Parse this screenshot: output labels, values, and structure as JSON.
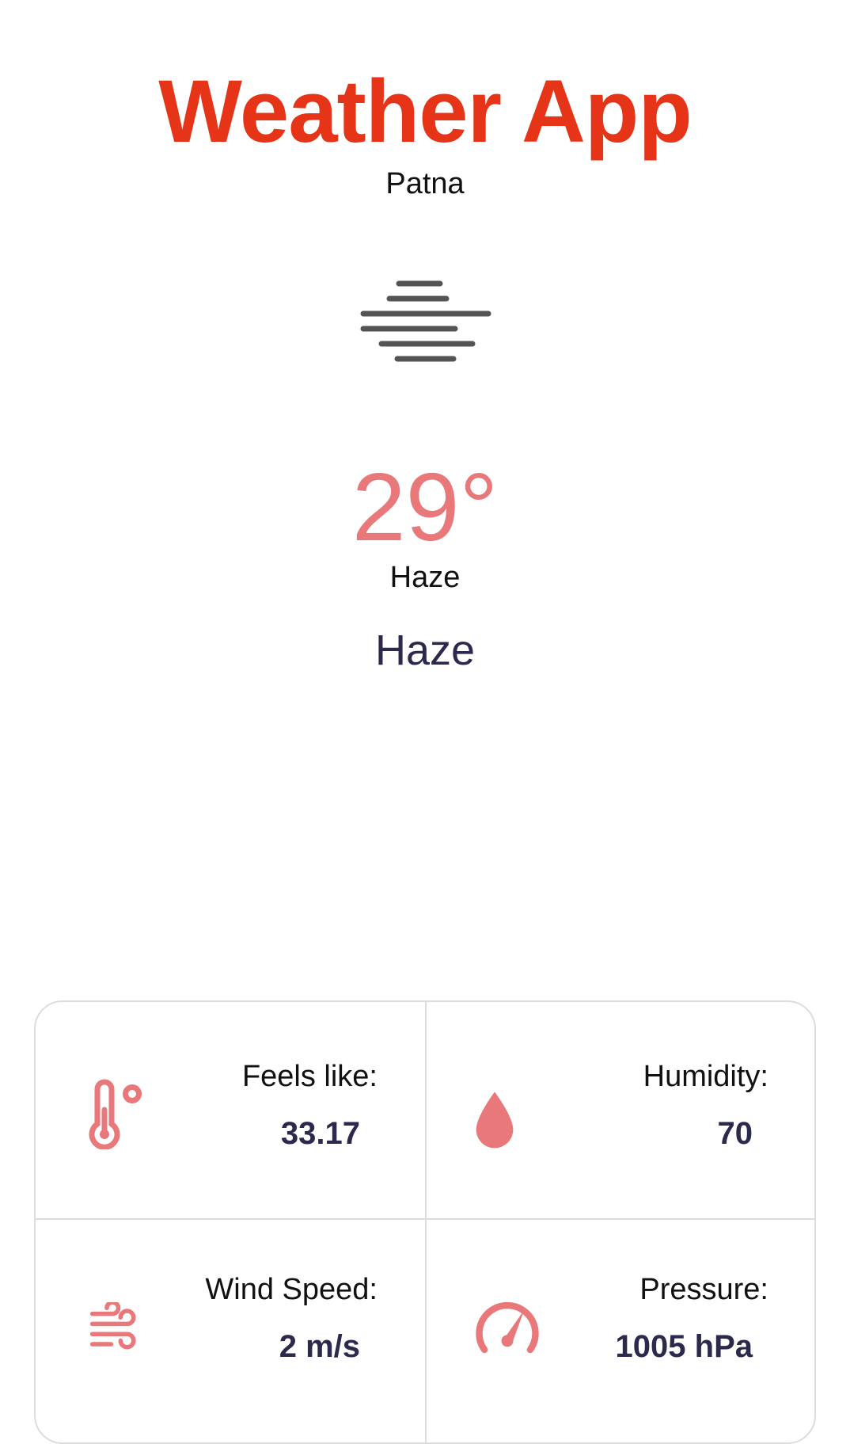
{
  "app": {
    "title": "Weather App",
    "city": "Patna"
  },
  "current": {
    "temperature": "29°",
    "condition_main": "Haze",
    "condition_description": "Haze",
    "icon": "haze-icon"
  },
  "details": [
    {
      "label": "Feels like:",
      "value": "33.17",
      "icon": "thermometer-icon"
    },
    {
      "label": "Humidity:",
      "value": "70",
      "icon": "humidity-drop-icon"
    },
    {
      "label": "Wind Speed:",
      "value": "2 m/s",
      "icon": "wind-icon"
    },
    {
      "label": "Pressure:",
      "value": "1005 hPa",
      "icon": "pressure-gauge-icon"
    }
  ],
  "colors": {
    "title": "#e53417",
    "accent": "#e8787a",
    "text_dark": "#2b2a4c"
  }
}
